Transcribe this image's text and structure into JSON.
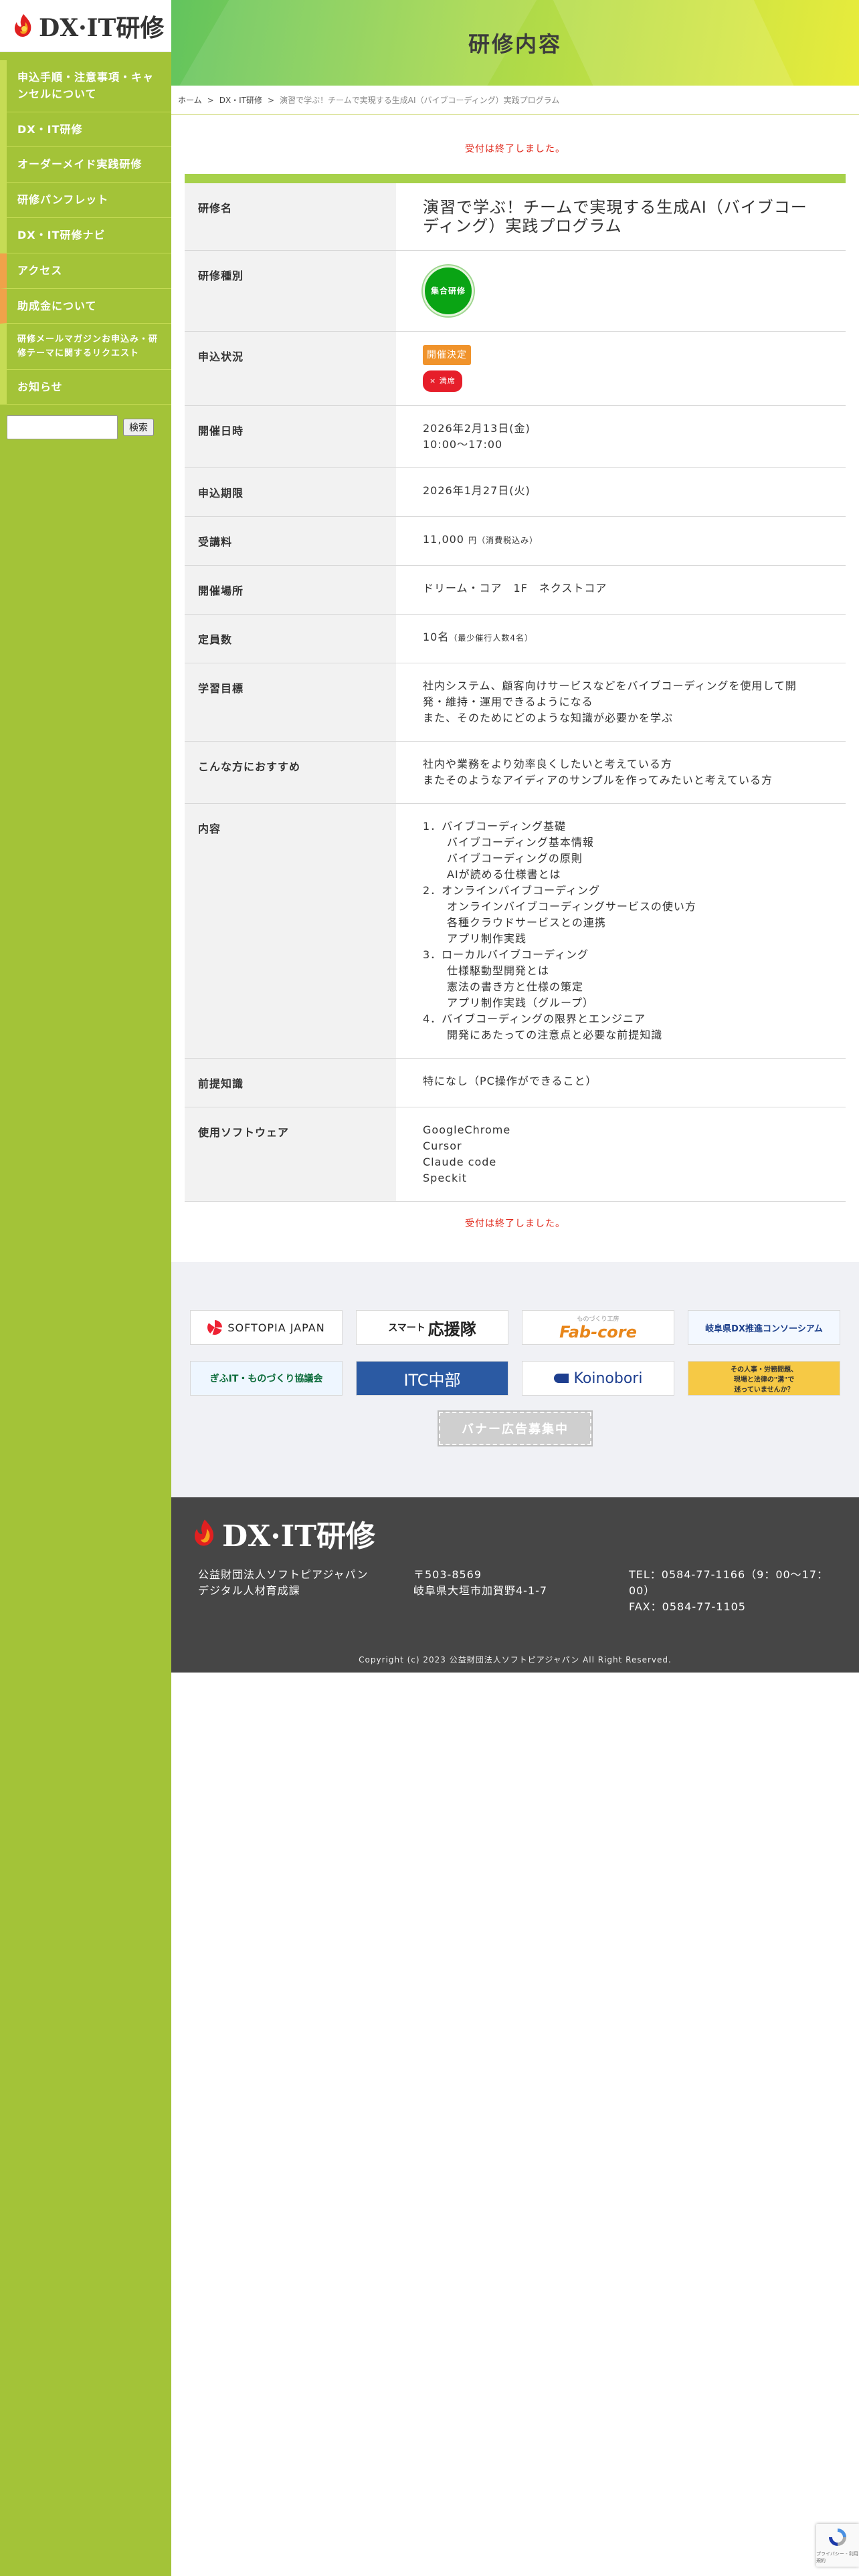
{
  "sidebar": {
    "logo_text": "DX·IT研修",
    "nav": [
      {
        "label": "申込手順・注意事項・キャンセルについて"
      },
      {
        "label": "DX・IT研修"
      },
      {
        "label": "オーダーメイド実践研修"
      },
      {
        "label": "研修パンフレット"
      },
      {
        "label": "DX・IT研修ナビ"
      },
      {
        "label": "アクセス"
      },
      {
        "label": "助成金について"
      },
      {
        "label": "研修メールマガジンお申込み・研修テーマに関するリクエスト"
      },
      {
        "label": "お知らせ"
      }
    ],
    "search": {
      "placeholder": "",
      "button_label": "検索"
    }
  },
  "header": {
    "title": "研修内容"
  },
  "breadcrumb": {
    "home": "ホーム",
    "sep": ">",
    "category": "DX・IT研修",
    "current": "演習で学ぶ！チームで実現する生成AI（バイブコーディング）実践プログラム"
  },
  "notice": "受付は終了しました。",
  "course": {
    "name_label": "研修名",
    "name": "演習で学ぶ！チームで実現する生成AI（バイブコーディング）実践プログラム",
    "type_label": "研修種別",
    "type_badge": "集合研修",
    "status_label": "申込状況",
    "status_tag": "開催決定",
    "status_closed": "× 満席",
    "date_label": "開催日時",
    "date": "2026年2月13日(金)",
    "time": "10:00〜17:00",
    "deadline_label": "申込期限",
    "deadline": "2026年1月27日(火)",
    "fee_label": "受講料",
    "fee": "11,000",
    "fee_note": "円（消費税込み）",
    "venue_label": "開催場所",
    "venue": "ドリーム・コア　1F　ネクストコア",
    "capacity_label": "定員数",
    "capacity": "10名",
    "capacity_note": "（最少催行人数4名）",
    "goal_label": "学習目標",
    "goal_lines": [
      "社内システム、顧客向けサービスなどをバイブコーディングを使用して開発・維持・運用できるようになる",
      "また、そのためにどのような知識が必要かを学ぶ"
    ],
    "target_label": "こんな方におすすめ",
    "target_lines": [
      "社内や業務をより効率良くしたいと考えている方",
      "またそのようなアイディアのサンプルを作ってみたいと考えている方"
    ],
    "content_label": "内容",
    "content": [
      {
        "text": "1．バイブコーディング基礎",
        "sub": false
      },
      {
        "text": "バイブコーディング基本情報",
        "sub": true
      },
      {
        "text": "バイブコーディングの原則",
        "sub": true
      },
      {
        "text": "AIが読める仕様書とは",
        "sub": true
      },
      {
        "text": "2．オンラインバイブコーディング",
        "sub": false
      },
      {
        "text": "オンラインバイブコーディングサービスの使い方",
        "sub": true
      },
      {
        "text": "各種クラウドサービスとの連携",
        "sub": true
      },
      {
        "text": "アプリ制作実践",
        "sub": true
      },
      {
        "text": "3．ローカルバイブコーディング",
        "sub": false
      },
      {
        "text": "仕様駆動型開発とは",
        "sub": true
      },
      {
        "text": "憲法の書き方と仕様の策定",
        "sub": true
      },
      {
        "text": "アプリ制作実践（グループ）",
        "sub": true
      },
      {
        "text": "4．バイブコーディングの限界とエンジニア",
        "sub": false
      },
      {
        "text": "開発にあたっての注意点と必要な前提知識",
        "sub": true
      }
    ],
    "prereq_label": "前提知識",
    "prereq": "特になし（PC操作ができること）",
    "software_label": "使用ソフトウェア",
    "software": [
      "GoogleChrome",
      "Cursor",
      "Claude code",
      "Speckit"
    ]
  },
  "banners": {
    "b1": "SOFTOPIA JAPAN",
    "b2a": "スマート",
    "b2b": "応援隊",
    "b3a": "ものづくり工房",
    "b3b": "Fab-core",
    "b4": "岐阜県DX推進コンソーシアム",
    "b5": "ぎふIT・ものづくり協議会",
    "b6": "ITC中部",
    "b7": "Koinobori",
    "b8a": "その人事・労務問題、",
    "b8b": "現場と法律の\"溝\"で",
    "b8c": "迷っていませんか？",
    "recruit": "バナー広告募集中"
  },
  "footer": {
    "logo_text": "DX·IT研修",
    "org1": "公益財団法人ソフトピアジャパン",
    "org2": "デジタル人材育成課",
    "zip": "〒503-8569",
    "address": "岐阜県大垣市加賀野4-1-7",
    "tel": "TEL：0584-77-1166（9：00〜17：00）",
    "fax": "FAX：0584-77-1105",
    "copyright": "Copyright (c) 2023 公益財団法人ソフトピアジャパン All Right Reserved."
  },
  "recaptcha": {
    "links": "プライバシー - 利用規約"
  },
  "colors": {
    "accent": "#a3c338",
    "notice": "#e0281b",
    "badge": "#0aa414",
    "status": "#f0932b"
  }
}
